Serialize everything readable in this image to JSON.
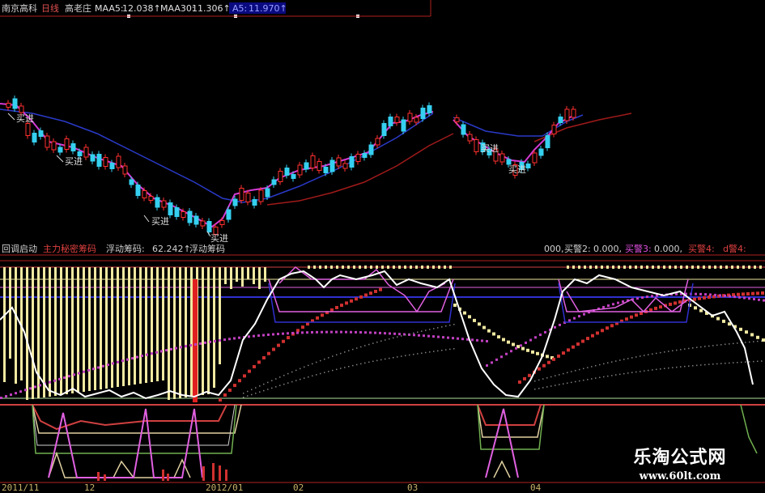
{
  "top_header": {
    "stock_name": "南京高科",
    "period": "日线",
    "indicator_name": "高老庄",
    "ma5_label": "MAA5:",
    "ma5_value": "12.038↑",
    "ma30_label": "MAA30:",
    "ma30_value": "11.306↑",
    "ma_other_label": "A5:",
    "ma_other_value": "11.970↑"
  },
  "annotations": [
    "买进",
    "买进",
    "买进",
    "买进",
    "买进",
    "买进"
  ],
  "lower_header": {
    "indicator_title": "回调启动",
    "main_chip_label": "主力秘密筹码",
    "float_chip_label": "浮动筹码:",
    "float_chip_value": "62.242↑",
    "float_chip2_label": "浮动筹码",
    "alert_prefix": "000,",
    "alert2_label": "买警2:",
    "alert2_value": "0.000,",
    "alert3_label": "买警3:",
    "alert3_value": "0.000,",
    "alert4_label": "买警4:",
    "alert5_label": "d警4:"
  },
  "dates": [
    "2011/11",
    "12",
    "2012/01",
    "02",
    "03",
    "04"
  ],
  "logo": {
    "name": "乐淘公式网",
    "url": "www.60lt.com"
  },
  "colors": {
    "up": "#ff3030",
    "down": "#35d0f0",
    "ma_magenta": "#d43ad4",
    "ma_blue": "#2a3ac8",
    "ma_red": "#a01a1a",
    "bars_yellow": "#f0e8a0",
    "white_line": "#ffffff"
  }
}
